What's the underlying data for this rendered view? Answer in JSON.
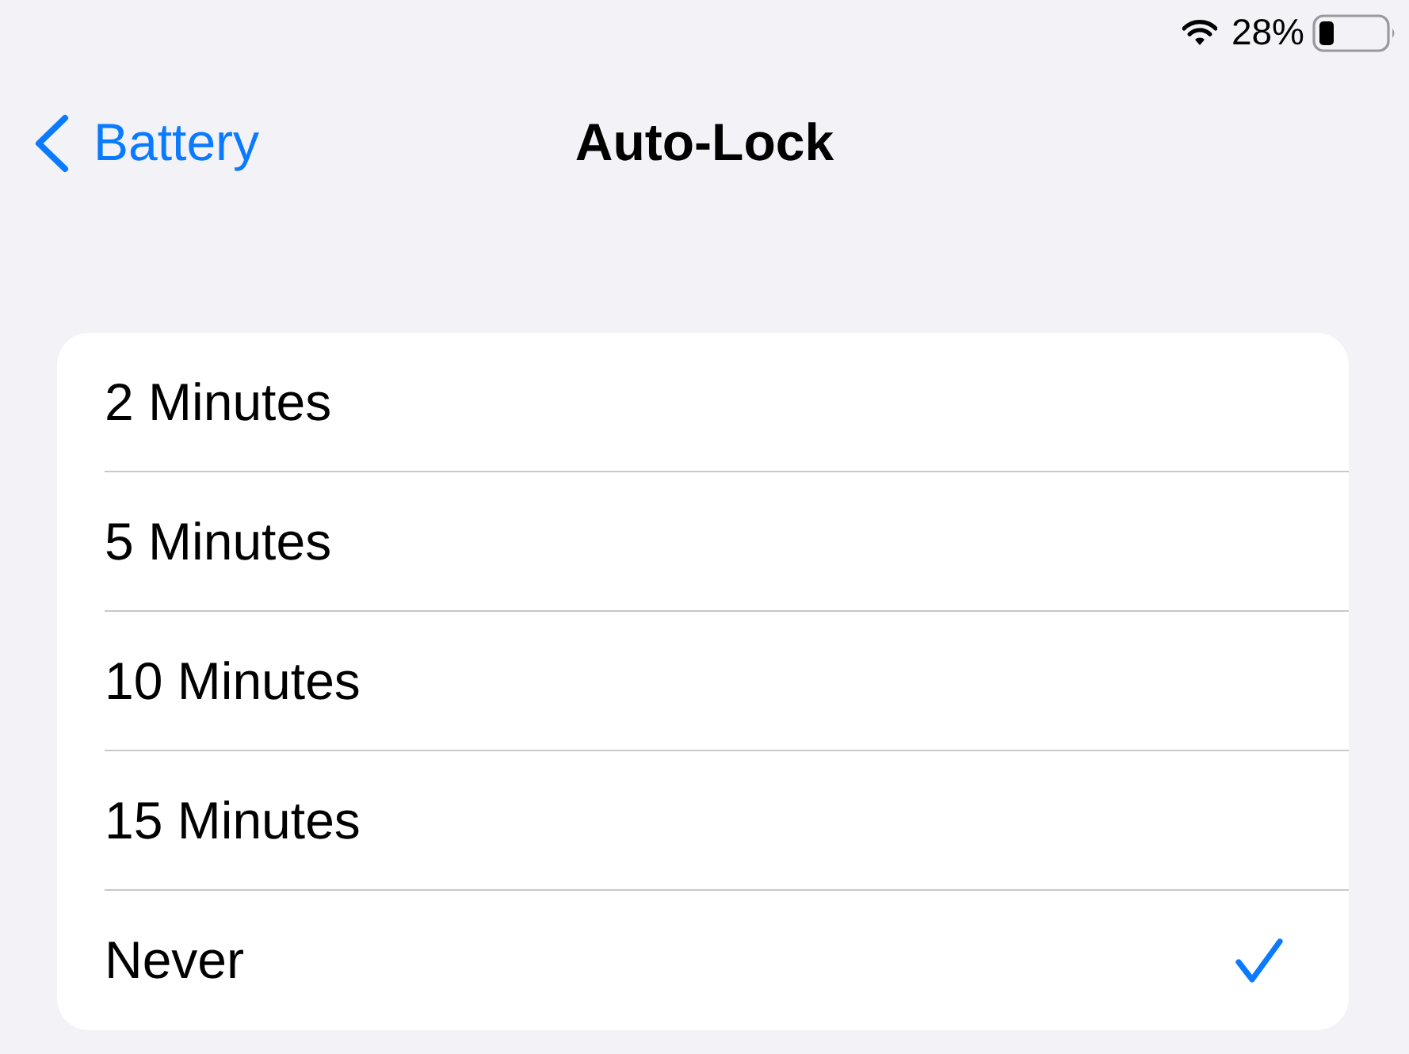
{
  "status_bar": {
    "battery_text": "28%"
  },
  "nav_bar": {
    "back_label": "Battery",
    "title": "Auto-Lock"
  },
  "options": [
    {
      "label": "2 Minutes",
      "selected": false
    },
    {
      "label": "5 Minutes",
      "selected": false
    },
    {
      "label": "10 Minutes",
      "selected": false
    },
    {
      "label": "15 Minutes",
      "selected": false
    },
    {
      "label": "Never",
      "selected": true
    }
  ]
}
